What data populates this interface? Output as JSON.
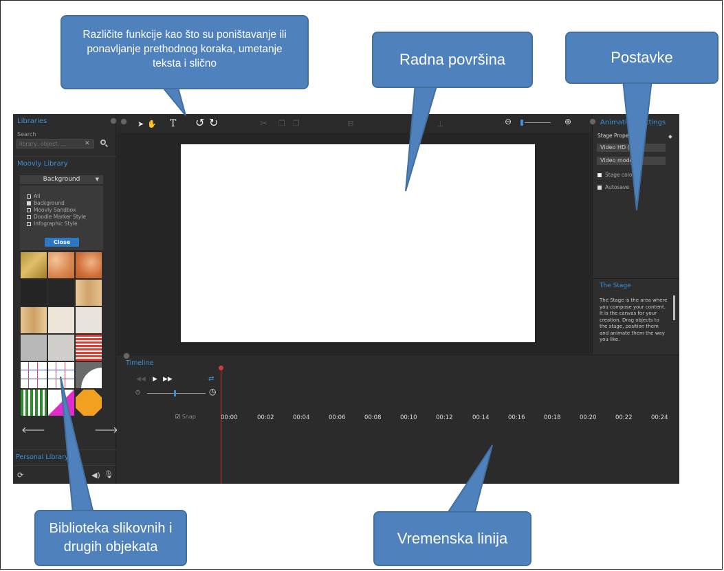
{
  "callouts": {
    "functions": "Različite funkcije kao što su poništavanje ili ponavljanje prethodnog koraka, umetanje teksta i slično",
    "workspace": "Radna površina",
    "settings": "Postavke",
    "library": "Biblioteka slikovnih i drugih objekata",
    "timeline": "Vremenska linija"
  },
  "sidebar": {
    "title": "Libraries",
    "search_label": "Search",
    "search_placeholder": "library, object, ...",
    "moovly_library": "Moovly Library",
    "category": "Background",
    "filters": [
      {
        "label": "All",
        "checked": false
      },
      {
        "label": "Background",
        "checked": true
      },
      {
        "label": "Moovly Sandbox",
        "checked": false
      },
      {
        "label": "Doodle Marker Style",
        "checked": false
      },
      {
        "label": "Infographic Style",
        "checked": false
      }
    ],
    "close_label": "Close",
    "personal_library": "Personal Library"
  },
  "toolbar": {
    "icons": [
      "select-icon",
      "hand-icon",
      "text-icon",
      "undo-icon",
      "redo-icon",
      "cut-icon",
      "copy-icon",
      "paste-icon",
      "align-icon",
      "center-icon",
      "zoom-out-icon",
      "zoom-in-icon"
    ]
  },
  "settings": {
    "title": "Animation Settings",
    "stage_properties": "Stage Properties",
    "video_format": "Video HD (16:9)",
    "mode": "Video mode",
    "stage_color": "Stage color",
    "autosave": "Autosave"
  },
  "stage_help": {
    "title": "The Stage",
    "description": "The Stage is the area where you compose your content. It is the canvas for your creation. Drag objects to the stage, position them and animate them the way you like."
  },
  "timeline": {
    "title": "Timeline",
    "snap_label": "Snap",
    "ticks": [
      "00:00",
      "00:02",
      "00:04",
      "00:06",
      "00:08",
      "00:10",
      "00:12",
      "00:14",
      "00:16",
      "00:18",
      "00:20",
      "00:22",
      "00:24"
    ]
  },
  "colors": {
    "callout_fill": "#4f81bd",
    "accent": "#3a8fd6",
    "playhead": "#d23b3b"
  }
}
